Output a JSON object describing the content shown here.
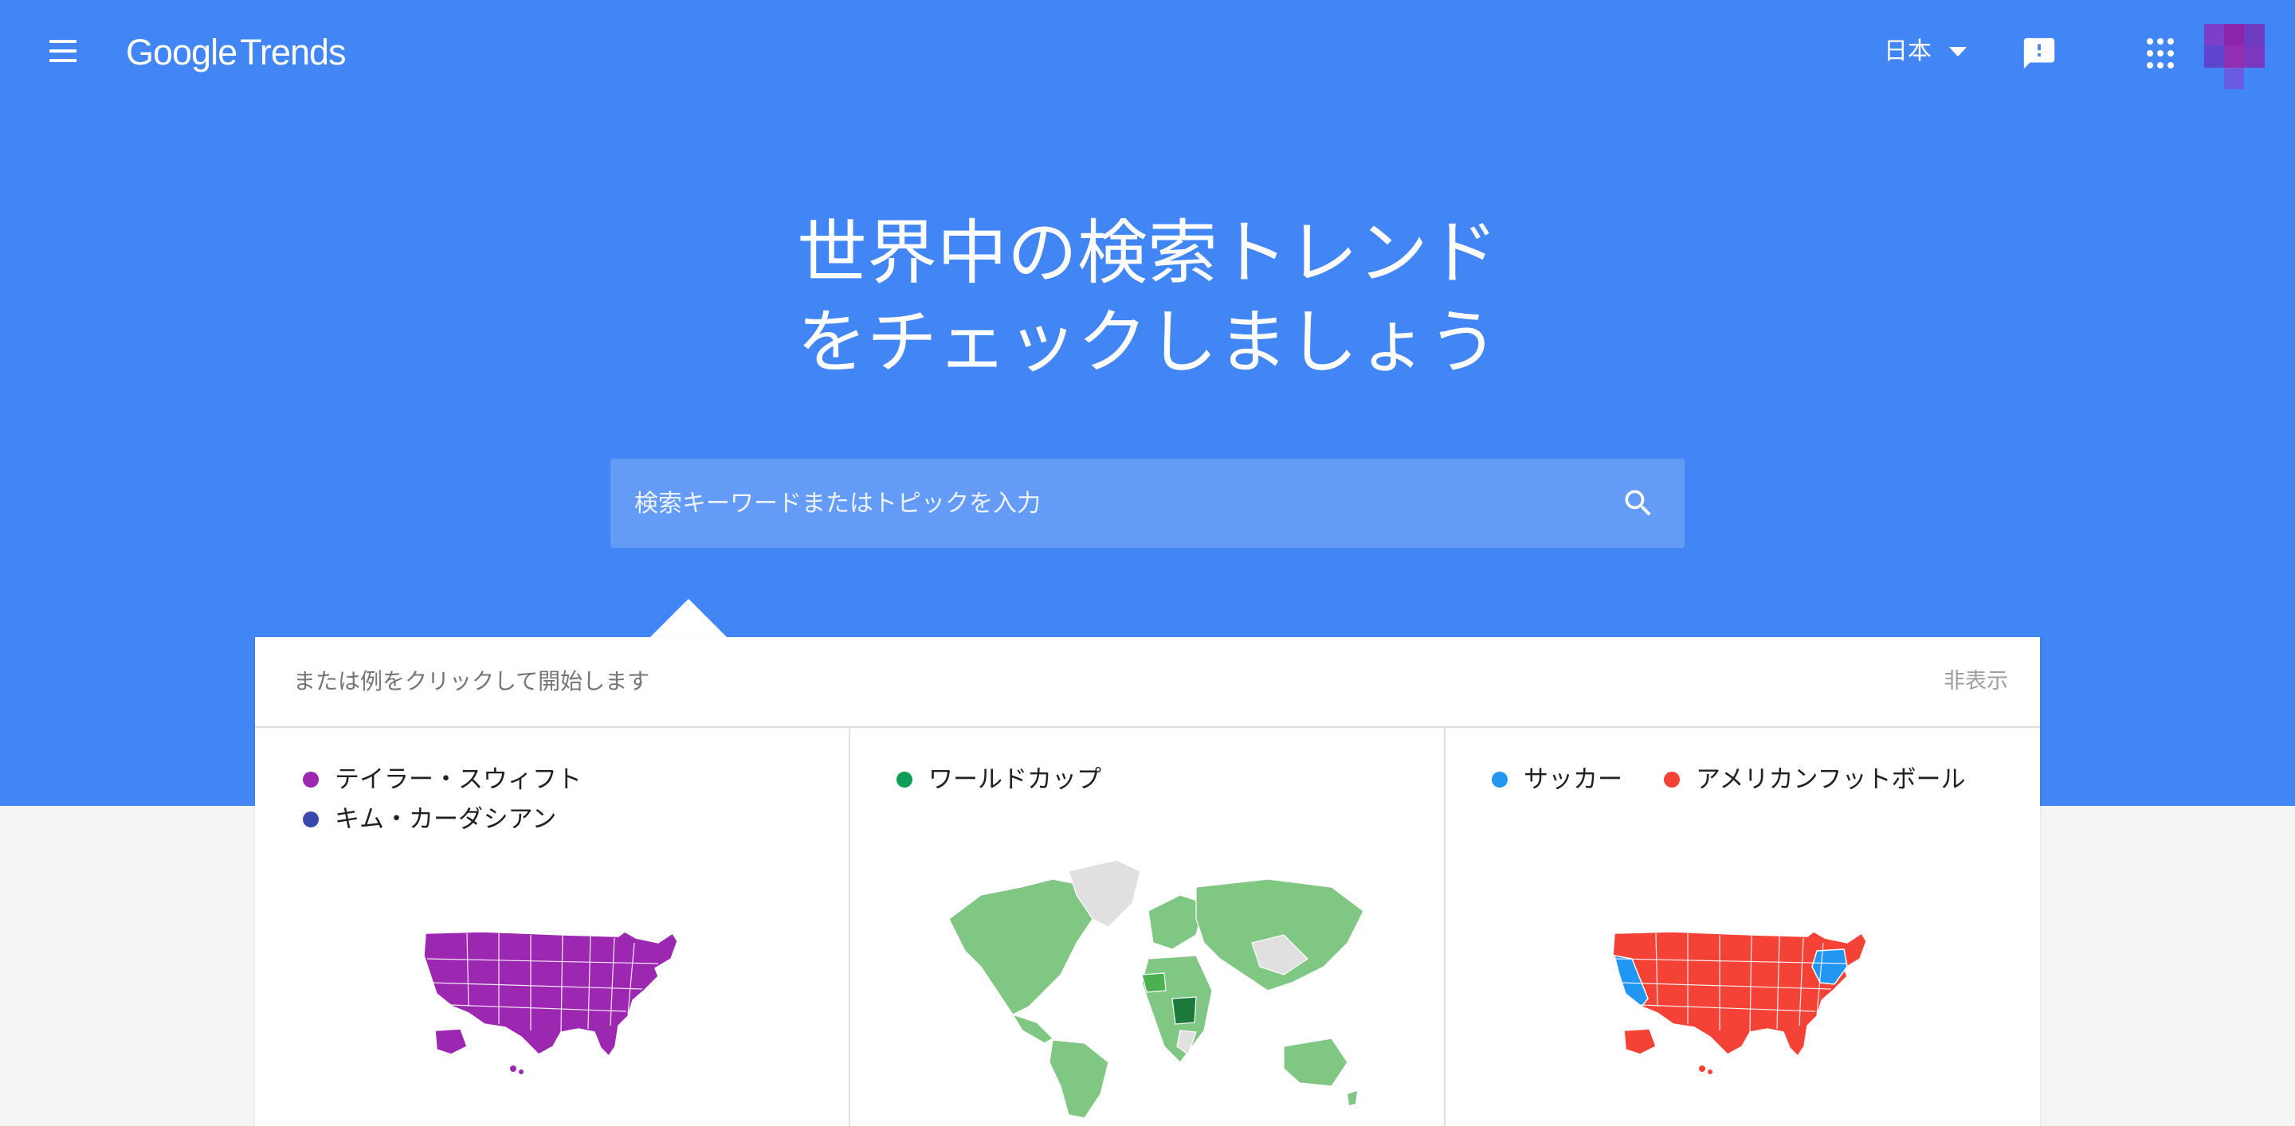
{
  "header": {
    "logo_google": "Google",
    "logo_trends": "Trends",
    "region": "日本"
  },
  "hero": {
    "headline_line1": "世界中の検索トレンド",
    "headline_line2": "をチェックしましょう",
    "search_placeholder": "検索キーワードまたはトピックを入力"
  },
  "examples": {
    "prompt": "または例をクリックして開始します",
    "hide_label": "非表示",
    "cards": [
      {
        "terms": [
          {
            "label": "テイラー・スウィフト",
            "color": "#9c27b0"
          },
          {
            "label": "キム・カーダシアン",
            "color": "#3949ab"
          }
        ],
        "map": "us-map-purple"
      },
      {
        "terms": [
          {
            "label": "ワールドカップ",
            "color": "#0f9d58"
          }
        ],
        "map": "world-map-green"
      },
      {
        "terms": [
          {
            "label": "サッカー",
            "color": "#2196f3"
          },
          {
            "label": "アメリカンフットボール",
            "color": "#f44336"
          }
        ],
        "map": "us-map-red-blue"
      }
    ]
  },
  "colors": {
    "brand_blue": "#4285f4",
    "page_bg": "#f5f5f5"
  }
}
